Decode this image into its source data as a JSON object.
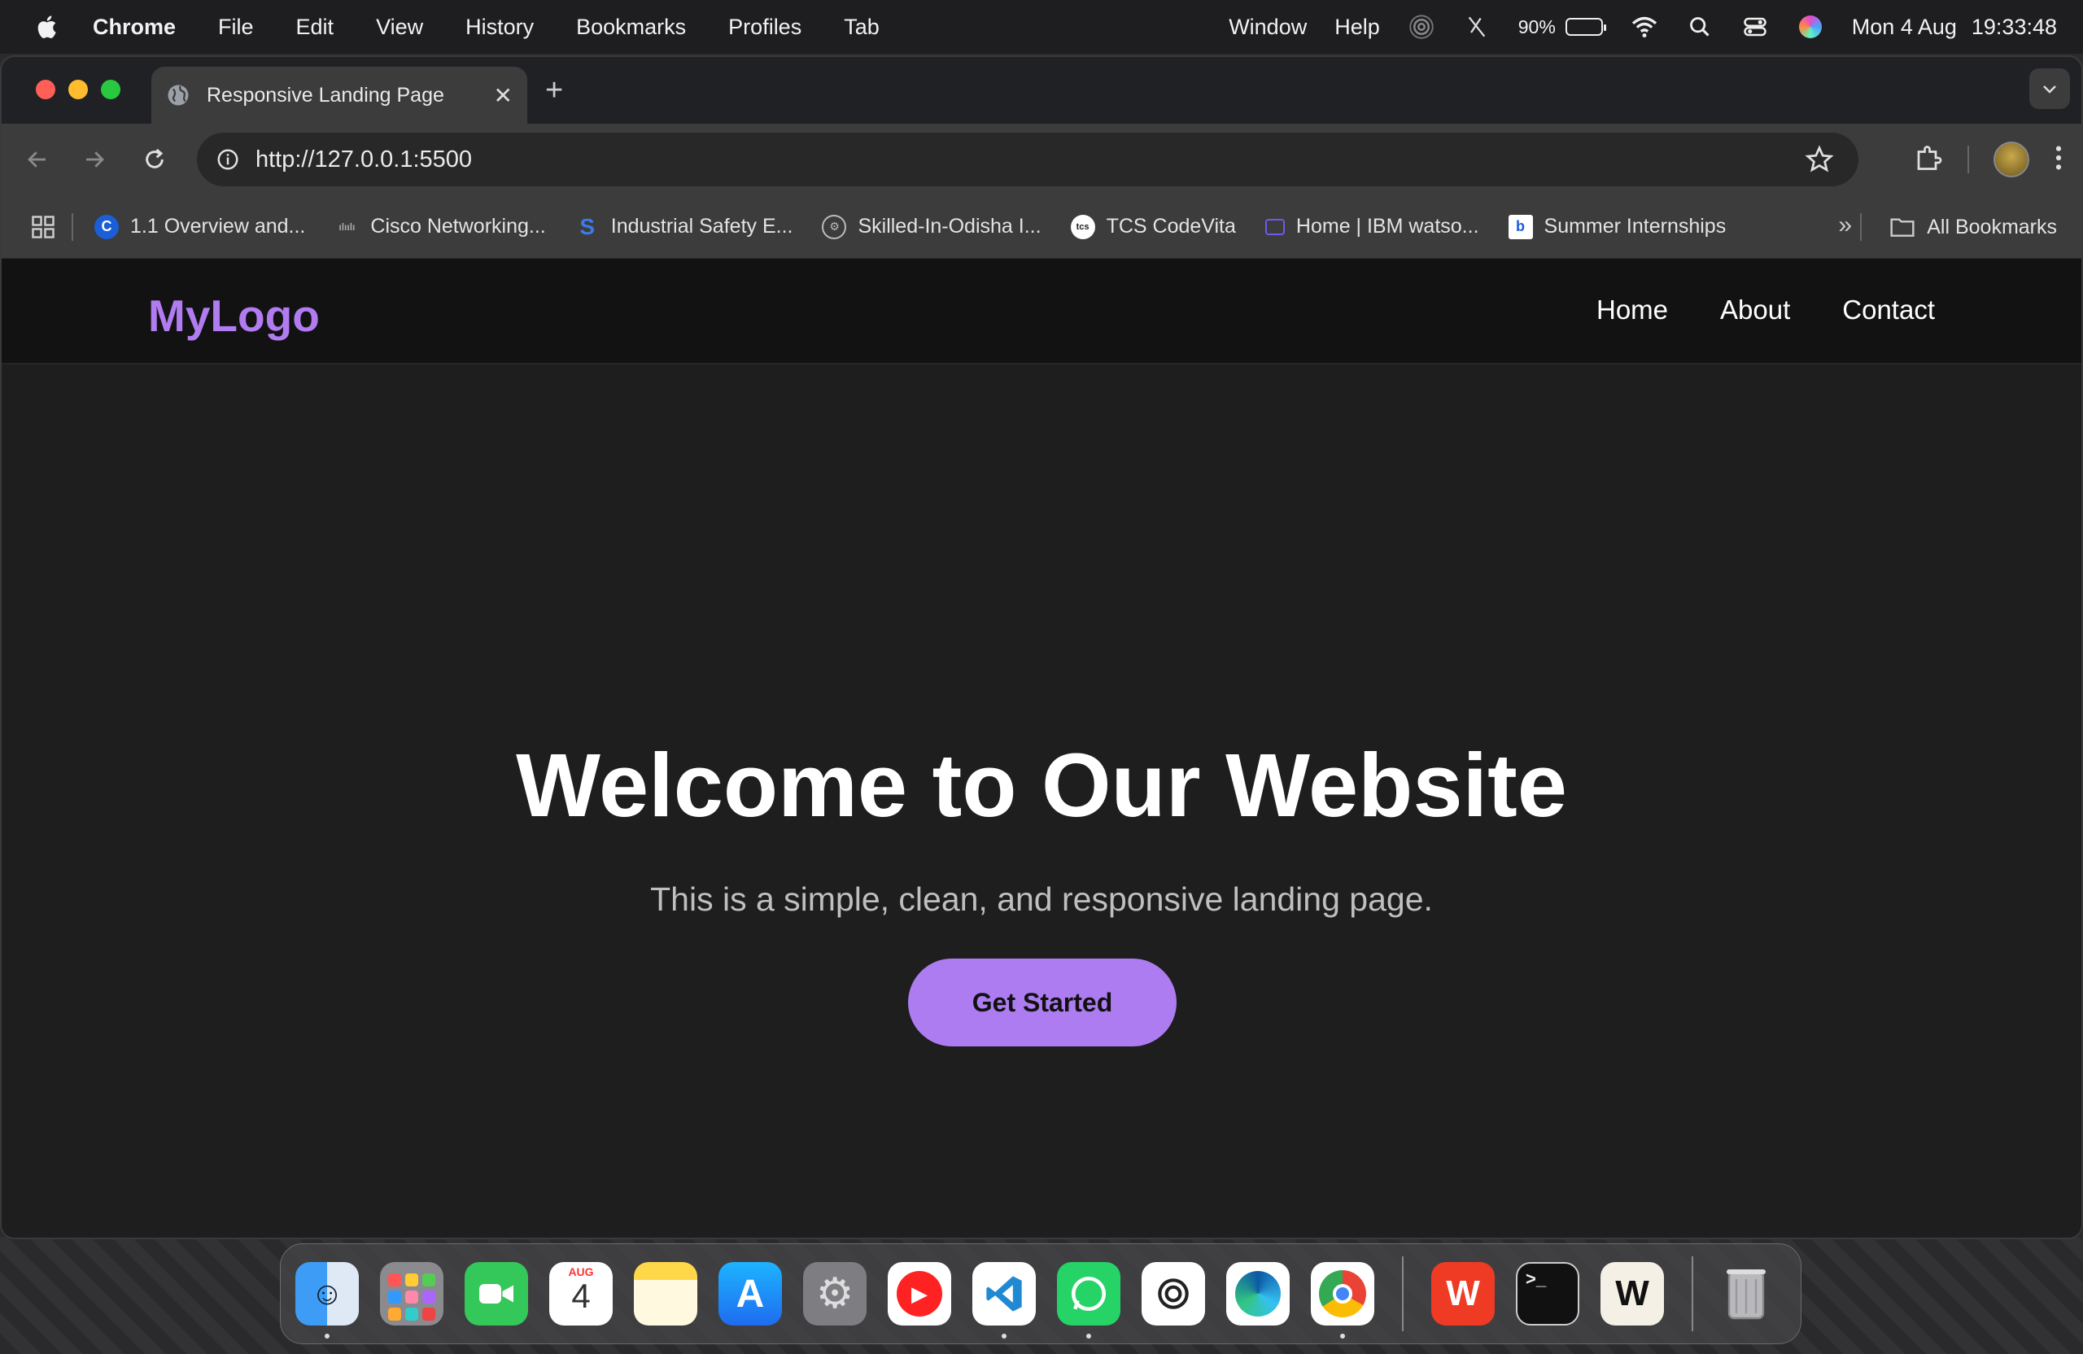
{
  "menubar": {
    "app_name": "Chrome",
    "items": [
      "File",
      "Edit",
      "View",
      "History",
      "Bookmarks",
      "Profiles",
      "Tab",
      "Window",
      "Help"
    ],
    "battery_percent": "90%",
    "date": "Mon 4 Aug",
    "time": "19:33:48"
  },
  "browser": {
    "tab_title": "Responsive Landing Page",
    "url": "http://127.0.0.1:5500",
    "bookmarks": [
      {
        "label": "1.1 Overview and...",
        "icon": "c-icon"
      },
      {
        "label": "Cisco Networking...",
        "icon": "cisco-icon"
      },
      {
        "label": "Industrial Safety E...",
        "icon": "s-icon"
      },
      {
        "label": "Skilled-In-Odisha I...",
        "icon": "gear-badge-icon"
      },
      {
        "label": "TCS CodeVita",
        "icon": "tcs-icon"
      },
      {
        "label": "Home | IBM watso...",
        "icon": "ibm-icon"
      },
      {
        "label": "Summer Internships",
        "icon": "internshala-icon"
      }
    ],
    "all_bookmarks_label": "All Bookmarks"
  },
  "site": {
    "logo": "MyLogo",
    "nav": [
      "Home",
      "About",
      "Contact"
    ],
    "hero_title": "Welcome to Our Website",
    "hero_subtitle": "This is a simple, clean, and responsive landing page.",
    "cta_label": "Get Started",
    "accent_color": "#ad7cf0"
  },
  "dock": {
    "calendar_month": "AUG",
    "calendar_day": "4",
    "apps": [
      "finder",
      "launchpad",
      "facetime",
      "calendar",
      "notes",
      "app-store",
      "system-settings",
      "youtube-music",
      "vscode",
      "whatsapp",
      "chatgpt",
      "edge",
      "chrome",
      "wps-office",
      "terminal",
      "warp",
      "trash"
    ]
  }
}
